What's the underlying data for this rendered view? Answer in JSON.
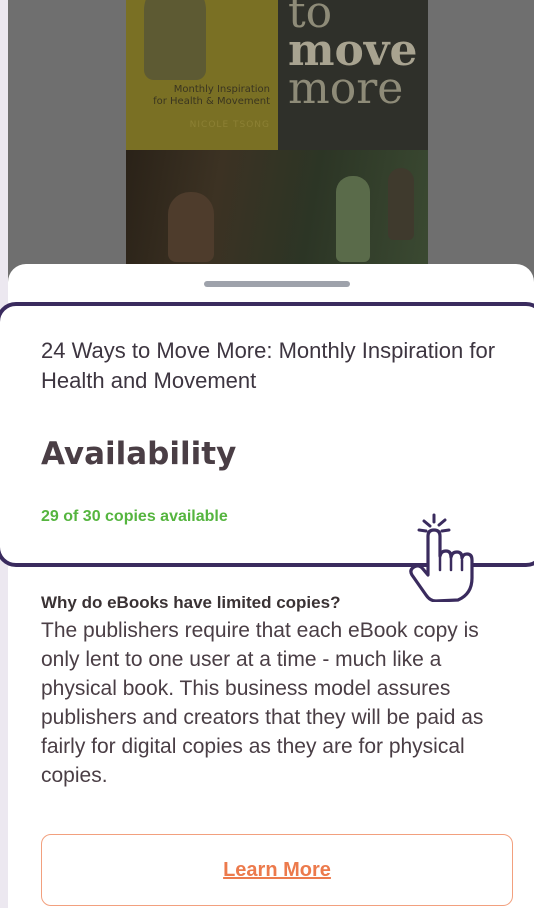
{
  "cover": {
    "title_line1": "to",
    "title_line2": "move",
    "title_line3": "more",
    "subtitle_line1": "Monthly Inspiration",
    "subtitle_line2": "for Health & Movement",
    "author": "NICOLE TSONG"
  },
  "sheet": {
    "book_title": "24 Ways to Move More: Monthly Inspiration for Health and Movement",
    "availability_heading": "Availability",
    "copies_text": "29 of 30 copies available",
    "faq_question": "Why do eBooks have limited copies?",
    "faq_answer": "The publishers require that each eBook copy is only lent to one user at a time - much like a physical book. This business model assures publishers and creators that they will be paid as fairly for digital copies as they are for physical copies.",
    "learn_more_label": "Learn More"
  },
  "colors": {
    "highlight_border": "#3a2b5e",
    "available_green": "#55b53f",
    "link_orange": "#ec7a4c"
  }
}
